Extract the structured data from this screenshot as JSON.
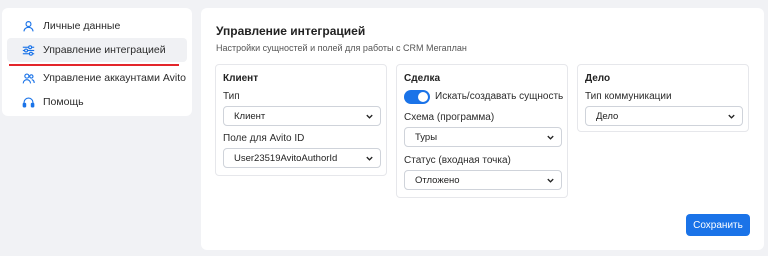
{
  "sidebar": {
    "items": [
      {
        "label": "Личные данные",
        "icon": "user-icon"
      },
      {
        "label": "Управление интеграцией",
        "icon": "sliders-icon",
        "active": true
      },
      {
        "label": "Управление аккаунтами Avito",
        "icon": "users-icon"
      },
      {
        "label": "Помощь",
        "icon": "headset-icon"
      }
    ]
  },
  "main": {
    "title": "Управление интеграцией",
    "subtitle": "Настройки сущностей и полей для работы с CRM Мегаплан",
    "client": {
      "title": "Клиент",
      "type_label": "Тип",
      "type_value": "Клиент",
      "field_label": "Поле для Avito ID",
      "field_value": "User23519AvitoAuthorId"
    },
    "deal": {
      "title": "Сделка",
      "toggle_label": "Искать/создавать сущность",
      "toggle_on": true,
      "scheme_label": "Схема (программа)",
      "scheme_value": "Туры",
      "status_label": "Статус (входная точка)",
      "status_value": "Отложено"
    },
    "case": {
      "title": "Дело",
      "comm_label": "Тип коммуникации",
      "comm_value": "Дело"
    },
    "save_label": "Сохранить"
  },
  "colors": {
    "accent": "#1a73e8",
    "active_underline": "#e3262b",
    "background": "#f1f2f5"
  }
}
